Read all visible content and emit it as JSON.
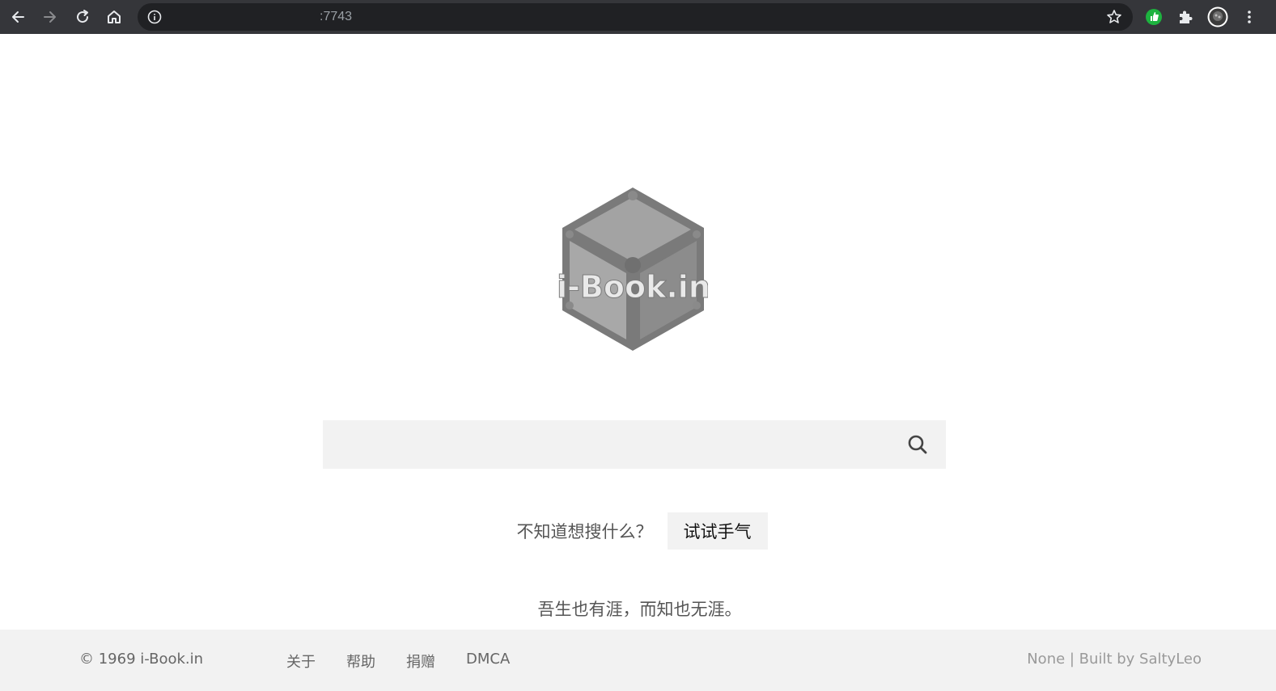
{
  "browser": {
    "url": ":7743",
    "icons": [
      "back-arrow-icon",
      "forward-arrow-icon",
      "reload-icon",
      "home-icon",
      "info-icon",
      "star-icon",
      "green-extension-icon",
      "puzzle-extension-icon",
      "profile-avatar-icon",
      "kebab-menu-icon"
    ]
  },
  "logo": {
    "text": "i-Book.in",
    "color": "#8a8a8a"
  },
  "search": {
    "placeholder": "",
    "value": "",
    "icon": "search-icon"
  },
  "lucky": {
    "prompt": "不知道想搜什么？",
    "button_label": "试试手气"
  },
  "motto": "吾生也有涯，而知也无涯。",
  "footer": {
    "copyright": "© 1969 i-Book.in",
    "links": [
      {
        "label": "关于"
      },
      {
        "label": "帮助"
      },
      {
        "label": "捐赠"
      },
      {
        "label": "DMCA"
      }
    ],
    "built_by": "None | Built by SaltyLeo"
  }
}
